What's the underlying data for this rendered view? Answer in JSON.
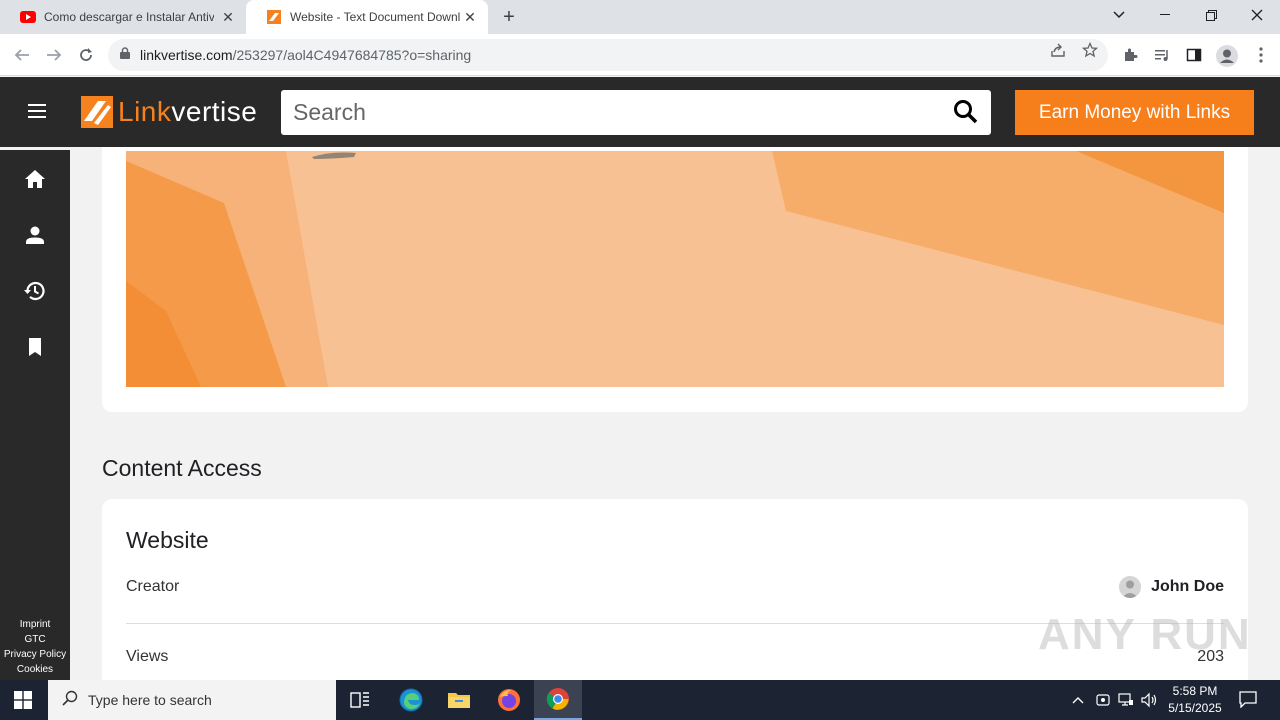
{
  "browser": {
    "tabs": [
      {
        "title": "Como descargar e Instalar Antivi",
        "active": false,
        "icon": "youtube-icon"
      },
      {
        "title": "Website - Text Document Downl",
        "active": true,
        "icon": "linkvertise-icon"
      }
    ],
    "url_host": "linkvertise.com",
    "url_path": "/253297/aol4C4947684785?o=sharing"
  },
  "header": {
    "search_placeholder": "Search",
    "logo_link": "Link",
    "logo_vertise": "vertise",
    "earn_button": "Earn Money with Links"
  },
  "sidebar": {
    "footer": [
      "Imprint",
      "GTC",
      "Privacy Policy",
      "Cookies"
    ]
  },
  "main": {
    "section_title": "Content Access",
    "content_name": "Website",
    "creator_label": "Creator",
    "creator_name": "John Doe",
    "views_label": "Views",
    "views_value": "203"
  },
  "watermark": "ANY RUN",
  "taskbar": {
    "search_text": "Type here to search",
    "time": "5:58 PM",
    "date": "5/15/2025"
  },
  "colors": {
    "accent": "#f77f1b",
    "header_bg": "#292929"
  }
}
